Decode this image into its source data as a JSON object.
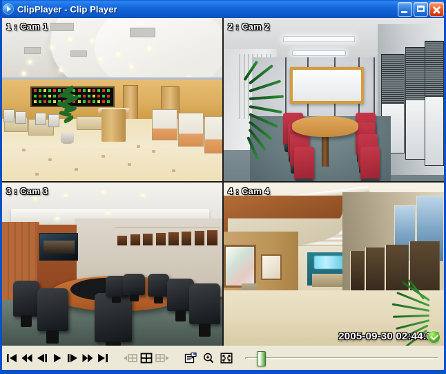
{
  "window": {
    "title": "ClipPlayer - Clip Player",
    "app_icon": "play-circle-icon",
    "accent_color": "#0A50C8",
    "toolbar_color": "#ECE9D8"
  },
  "titlebar_buttons": [
    {
      "name": "minimize",
      "label": "_"
    },
    {
      "name": "maximize",
      "label": "□"
    },
    {
      "name": "close",
      "label": "✕"
    }
  ],
  "grid": {
    "layout": "2x2",
    "cells": [
      {
        "index": "1",
        "label": "1 : Cam 1",
        "scene": "bank-lobby"
      },
      {
        "index": "2",
        "label": "2 : Cam 2",
        "scene": "conference-room"
      },
      {
        "index": "3",
        "label": "3 : Cam 3",
        "scene": "boardroom"
      },
      {
        "index": "4",
        "label": "4 : Cam 4",
        "scene": "hotel-corridor"
      }
    ],
    "timestamp": "2005-09-30 02:44:37",
    "status_badge": "ok-check-green",
    "status_badge_color": "#5fc124"
  },
  "toolbar": {
    "transport": [
      {
        "name": "skip-to-start-button",
        "icon": "skip-start-icon",
        "title": "First"
      },
      {
        "name": "rewind-button",
        "icon": "rewind-icon",
        "title": "Rewind"
      },
      {
        "name": "step-back-button",
        "icon": "step-back-icon",
        "title": "Step Back"
      },
      {
        "name": "play-button",
        "icon": "play-icon",
        "title": "Play"
      },
      {
        "name": "step-forward-button",
        "icon": "step-forward-icon",
        "title": "Step Forward"
      },
      {
        "name": "fast-forward-button",
        "icon": "fast-forward-icon",
        "title": "Fast Forward"
      },
      {
        "name": "skip-to-end-button",
        "icon": "skip-end-icon",
        "title": "Last"
      }
    ],
    "layout_controls": [
      {
        "name": "prev-layout-button",
        "icon": "grid-prev-icon",
        "enabled": false
      },
      {
        "name": "grid-2x2-button",
        "icon": "grid-2x2-icon",
        "enabled": true
      },
      {
        "name": "next-layout-button",
        "icon": "grid-next-icon",
        "enabled": false
      }
    ],
    "tools": [
      {
        "name": "properties-button",
        "icon": "properties-icon",
        "enabled": true
      },
      {
        "name": "zoom-button",
        "icon": "magnifier-plus-icon",
        "enabled": true
      },
      {
        "name": "fullscreen-button",
        "icon": "fullscreen-icon",
        "enabled": true
      }
    ],
    "slider": {
      "name": "seek-slider",
      "value_percent": 8,
      "min": 0,
      "max": 100
    }
  }
}
